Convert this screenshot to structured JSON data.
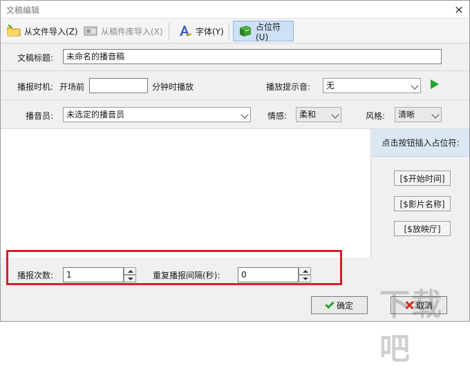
{
  "window": {
    "title": "文稿编辑"
  },
  "toolbar": {
    "import_file": "从文件导入(Z)",
    "import_library": "从稿件库导入(X)",
    "font": "字体(Y)",
    "placeholder": "占位符(U)"
  },
  "form": {
    "title_label": "文稿标题:",
    "title_value": "未命名的播音稿",
    "time_label": "播报时机:",
    "time_prefix": "开场前",
    "time_value": "",
    "time_suffix": "分钟时播放",
    "prompt_label": "播放提示音:",
    "prompt_value": "无",
    "announcer_label": "播音员:",
    "announcer_value": "未选定的播音员",
    "emotion_label": "情感:",
    "emotion_value": "柔和",
    "style_label": "风格:",
    "style_value": "清晰"
  },
  "side": {
    "heading": "点击按钮插入占位符:",
    "buttons": [
      "[$开始时间]",
      "[$影片名称]",
      "[$放映厅]"
    ]
  },
  "repeat": {
    "count_label": "播报次数:",
    "count_value": "1",
    "interval_label": "重复播报间隔(秒):",
    "interval_value": "0"
  },
  "footer": {
    "ok": "确定",
    "cancel": "取消"
  },
  "watermark": {
    "text": "下载吧"
  },
  "colors": {
    "highlight": "#d21f2a",
    "accent": "#27a52b"
  }
}
